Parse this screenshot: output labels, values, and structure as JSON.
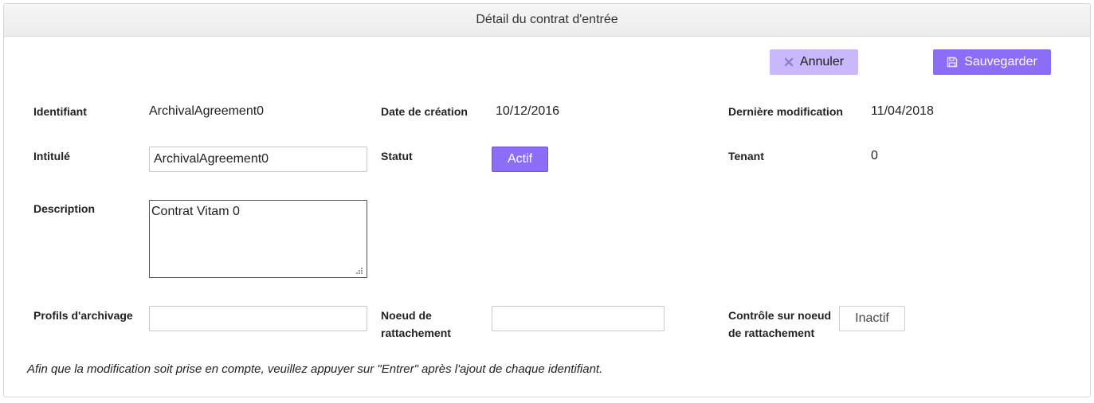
{
  "header": {
    "title": "Détail du contrat d'entrée"
  },
  "toolbar": {
    "cancel_label": "Annuler",
    "save_label": "Sauvegarder"
  },
  "fields": {
    "identifiant": {
      "label": "Identifiant",
      "value": "ArchivalAgreement0"
    },
    "date_creation": {
      "label": "Date de création",
      "value": "10/12/2016"
    },
    "derniere_modification": {
      "label": "Dernière modification",
      "value": "11/04/2018"
    },
    "intitule": {
      "label": "Intitulé",
      "value": "ArchivalAgreement0"
    },
    "statut": {
      "label": "Statut",
      "value": "Actif"
    },
    "tenant": {
      "label": "Tenant",
      "value": "0"
    },
    "description": {
      "label": "Description",
      "value": "Contrat Vitam 0"
    },
    "profils": {
      "label": "Profils d'archivage",
      "value": ""
    },
    "noeud": {
      "label_line1": "Noeud de",
      "label_line2": "rattachement",
      "value": ""
    },
    "controle": {
      "label_line1": "Contrôle sur noeud",
      "label_line2": "de rattachement",
      "value": "Inactif"
    }
  },
  "note": "Afin que la modification soit prise en compte, veuillez appuyer sur \"Entrer\" après l'ajout de chaque identifiant.",
  "icons": {
    "cancel": "close-icon",
    "save": "floppy-disk-icon"
  },
  "colors": {
    "primary": "#8b6ef5",
    "primary_light": "#c9b8fb"
  }
}
